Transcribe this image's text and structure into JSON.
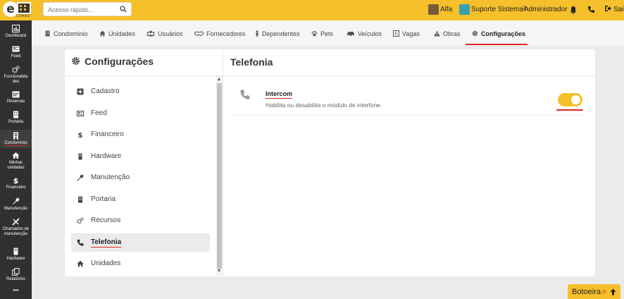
{
  "topbar": {
    "logo_text": "CONDO",
    "search_placeholder": "Acesso rápido...",
    "alfa_label": "Alfa",
    "suporte_label": "Suporte Sistema²",
    "user_label": "Administrador",
    "logout_label": "Sai"
  },
  "sidebar": {
    "items": [
      {
        "label": "Dashboard",
        "icon": "bar-chart-icon"
      },
      {
        "label": "Feed",
        "icon": "newspaper-icon"
      },
      {
        "label": "Funcionalida des",
        "icon": "cogs-icon"
      },
      {
        "label": "Reservas",
        "icon": "calendar-icon"
      },
      {
        "label": "Portaria",
        "icon": "building-icon"
      },
      {
        "label": "Condomínio",
        "icon": "condo-icon"
      },
      {
        "label": "Minhas unidades",
        "icon": "home-icon"
      },
      {
        "label": "Financeiro",
        "icon": "dollar-icon"
      },
      {
        "label": "Manutenção",
        "icon": "wrench-icon"
      },
      {
        "label": "Chamados de manutenção",
        "icon": "tools-icon"
      },
      {
        "label": "Hardware",
        "icon": "hdd-icon"
      },
      {
        "label": "Relatórios",
        "icon": "copy-icon"
      },
      {
        "label": "•••",
        "icon": "more-icon"
      }
    ]
  },
  "subnav": {
    "items": [
      {
        "label": "Condomínio"
      },
      {
        "label": "Unidades"
      },
      {
        "label": "Usuários"
      },
      {
        "label": "Fornecedores"
      },
      {
        "label": "Dependentes"
      },
      {
        "label": "Pets"
      },
      {
        "label": "Veículos"
      },
      {
        "label": "Vagas"
      },
      {
        "label": "Obras"
      },
      {
        "label": "Configurações"
      }
    ],
    "active": "Configurações"
  },
  "left_panel": {
    "title": "Configurações",
    "items": [
      {
        "label": "Cadastro"
      },
      {
        "label": "Feed"
      },
      {
        "label": "Financeiro"
      },
      {
        "label": "Hardware"
      },
      {
        "label": "Manutenção"
      },
      {
        "label": "Portaria"
      },
      {
        "label": "Recursos"
      },
      {
        "label": "Telefonia"
      },
      {
        "label": "Unidades"
      }
    ],
    "active": "Telefonia"
  },
  "right_panel": {
    "title": "Telefonia",
    "setting": {
      "name": "Intercom",
      "description": "Habilita ou desabilita o módulo de interfone.",
      "enabled": true
    }
  },
  "botoeira": {
    "label": "Botoeira"
  },
  "colors": {
    "accent": "#f6c02c",
    "sidebar": "#303030",
    "underline": "#e2261c"
  }
}
